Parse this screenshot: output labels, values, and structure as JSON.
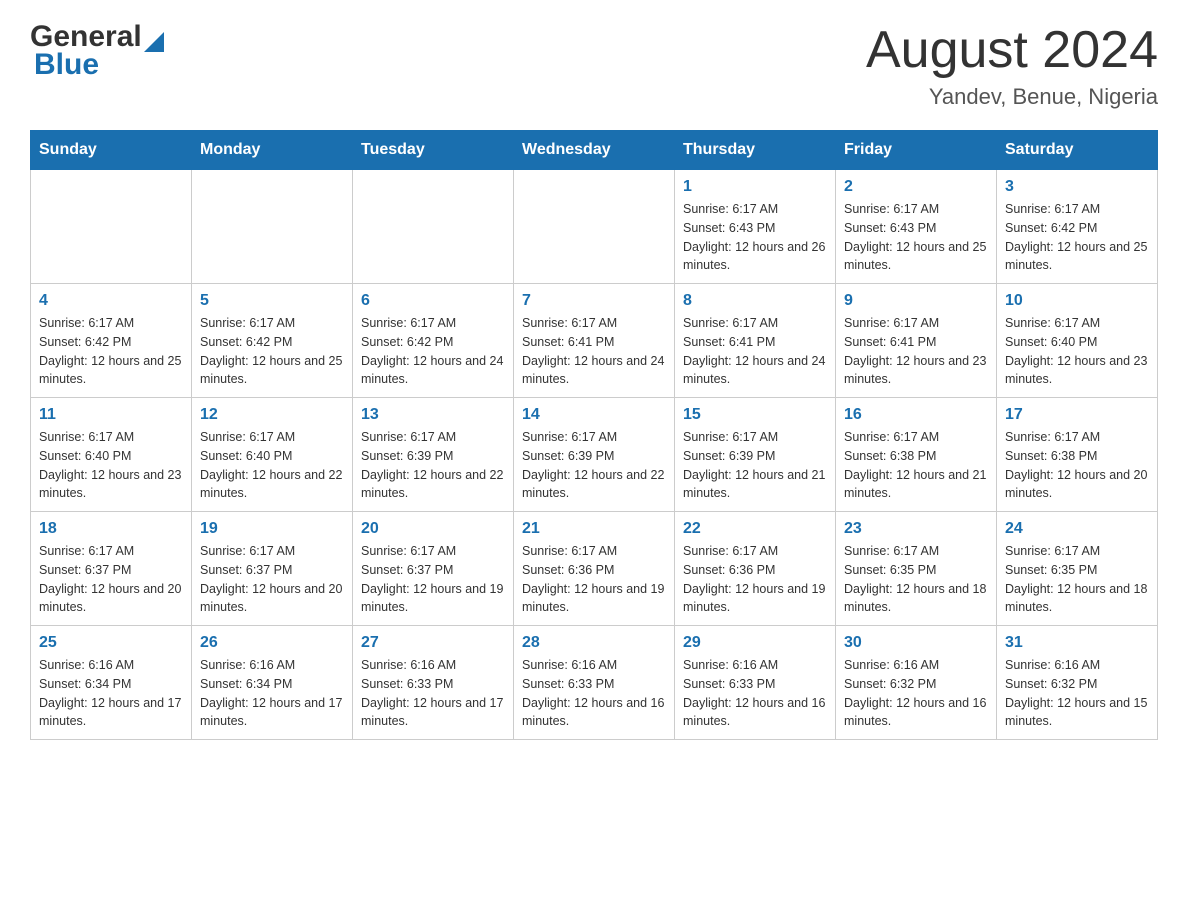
{
  "header": {
    "logo_general": "General",
    "logo_blue": "Blue",
    "month_title": "August 2024",
    "location": "Yandev, Benue, Nigeria"
  },
  "days_of_week": [
    "Sunday",
    "Monday",
    "Tuesday",
    "Wednesday",
    "Thursday",
    "Friday",
    "Saturday"
  ],
  "weeks": [
    [
      {
        "day": "",
        "info": ""
      },
      {
        "day": "",
        "info": ""
      },
      {
        "day": "",
        "info": ""
      },
      {
        "day": "",
        "info": ""
      },
      {
        "day": "1",
        "info": "Sunrise: 6:17 AM\nSunset: 6:43 PM\nDaylight: 12 hours and 26 minutes."
      },
      {
        "day": "2",
        "info": "Sunrise: 6:17 AM\nSunset: 6:43 PM\nDaylight: 12 hours and 25 minutes."
      },
      {
        "day": "3",
        "info": "Sunrise: 6:17 AM\nSunset: 6:42 PM\nDaylight: 12 hours and 25 minutes."
      }
    ],
    [
      {
        "day": "4",
        "info": "Sunrise: 6:17 AM\nSunset: 6:42 PM\nDaylight: 12 hours and 25 minutes."
      },
      {
        "day": "5",
        "info": "Sunrise: 6:17 AM\nSunset: 6:42 PM\nDaylight: 12 hours and 25 minutes."
      },
      {
        "day": "6",
        "info": "Sunrise: 6:17 AM\nSunset: 6:42 PM\nDaylight: 12 hours and 24 minutes."
      },
      {
        "day": "7",
        "info": "Sunrise: 6:17 AM\nSunset: 6:41 PM\nDaylight: 12 hours and 24 minutes."
      },
      {
        "day": "8",
        "info": "Sunrise: 6:17 AM\nSunset: 6:41 PM\nDaylight: 12 hours and 24 minutes."
      },
      {
        "day": "9",
        "info": "Sunrise: 6:17 AM\nSunset: 6:41 PM\nDaylight: 12 hours and 23 minutes."
      },
      {
        "day": "10",
        "info": "Sunrise: 6:17 AM\nSunset: 6:40 PM\nDaylight: 12 hours and 23 minutes."
      }
    ],
    [
      {
        "day": "11",
        "info": "Sunrise: 6:17 AM\nSunset: 6:40 PM\nDaylight: 12 hours and 23 minutes."
      },
      {
        "day": "12",
        "info": "Sunrise: 6:17 AM\nSunset: 6:40 PM\nDaylight: 12 hours and 22 minutes."
      },
      {
        "day": "13",
        "info": "Sunrise: 6:17 AM\nSunset: 6:39 PM\nDaylight: 12 hours and 22 minutes."
      },
      {
        "day": "14",
        "info": "Sunrise: 6:17 AM\nSunset: 6:39 PM\nDaylight: 12 hours and 22 minutes."
      },
      {
        "day": "15",
        "info": "Sunrise: 6:17 AM\nSunset: 6:39 PM\nDaylight: 12 hours and 21 minutes."
      },
      {
        "day": "16",
        "info": "Sunrise: 6:17 AM\nSunset: 6:38 PM\nDaylight: 12 hours and 21 minutes."
      },
      {
        "day": "17",
        "info": "Sunrise: 6:17 AM\nSunset: 6:38 PM\nDaylight: 12 hours and 20 minutes."
      }
    ],
    [
      {
        "day": "18",
        "info": "Sunrise: 6:17 AM\nSunset: 6:37 PM\nDaylight: 12 hours and 20 minutes."
      },
      {
        "day": "19",
        "info": "Sunrise: 6:17 AM\nSunset: 6:37 PM\nDaylight: 12 hours and 20 minutes."
      },
      {
        "day": "20",
        "info": "Sunrise: 6:17 AM\nSunset: 6:37 PM\nDaylight: 12 hours and 19 minutes."
      },
      {
        "day": "21",
        "info": "Sunrise: 6:17 AM\nSunset: 6:36 PM\nDaylight: 12 hours and 19 minutes."
      },
      {
        "day": "22",
        "info": "Sunrise: 6:17 AM\nSunset: 6:36 PM\nDaylight: 12 hours and 19 minutes."
      },
      {
        "day": "23",
        "info": "Sunrise: 6:17 AM\nSunset: 6:35 PM\nDaylight: 12 hours and 18 minutes."
      },
      {
        "day": "24",
        "info": "Sunrise: 6:17 AM\nSunset: 6:35 PM\nDaylight: 12 hours and 18 minutes."
      }
    ],
    [
      {
        "day": "25",
        "info": "Sunrise: 6:16 AM\nSunset: 6:34 PM\nDaylight: 12 hours and 17 minutes."
      },
      {
        "day": "26",
        "info": "Sunrise: 6:16 AM\nSunset: 6:34 PM\nDaylight: 12 hours and 17 minutes."
      },
      {
        "day": "27",
        "info": "Sunrise: 6:16 AM\nSunset: 6:33 PM\nDaylight: 12 hours and 17 minutes."
      },
      {
        "day": "28",
        "info": "Sunrise: 6:16 AM\nSunset: 6:33 PM\nDaylight: 12 hours and 16 minutes."
      },
      {
        "day": "29",
        "info": "Sunrise: 6:16 AM\nSunset: 6:33 PM\nDaylight: 12 hours and 16 minutes."
      },
      {
        "day": "30",
        "info": "Sunrise: 6:16 AM\nSunset: 6:32 PM\nDaylight: 12 hours and 16 minutes."
      },
      {
        "day": "31",
        "info": "Sunrise: 6:16 AM\nSunset: 6:32 PM\nDaylight: 12 hours and 15 minutes."
      }
    ]
  ],
  "colors": {
    "header_bg": "#1a6faf",
    "header_text": "#ffffff",
    "day_number": "#1a6faf"
  }
}
